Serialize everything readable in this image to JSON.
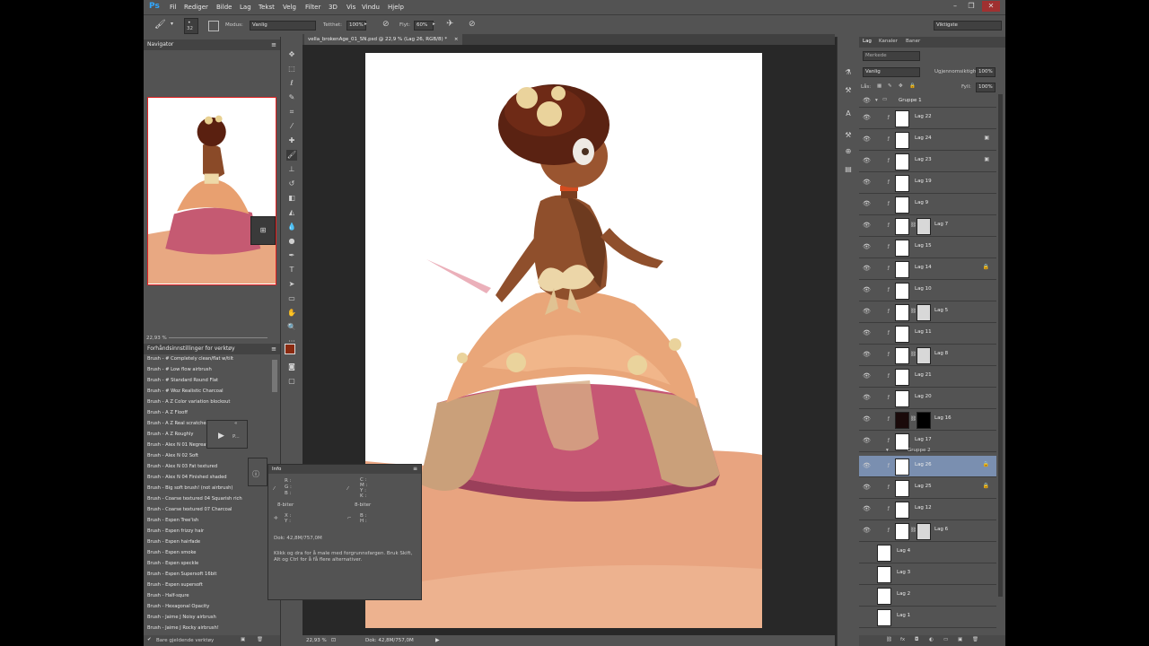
{
  "app": {
    "logo": "Ps"
  },
  "menu": [
    "Fil",
    "Rediger",
    "Bilde",
    "Lag",
    "Tekst",
    "Velg",
    "Filter",
    "3D",
    "Vis",
    "Vindu",
    "Hjelp"
  ],
  "options": {
    "brush_size": "32",
    "mode_label": "Modus:",
    "mode_value": "Vanlig",
    "opacity_label": "Tetthet:",
    "opacity_value": "100%",
    "flow_label": "Flyt:",
    "flow_value": "60%",
    "workspace": "Viktigste"
  },
  "document": {
    "tab_title": "vella_brokenAge_01_SN.psd @ 22,9 % (Lag 26, RGB/8) *",
    "zoom": "22,93 %",
    "doc_size": "Dok: 42,8M/757,0M"
  },
  "navigator": {
    "title": "Navigator",
    "zoom": "22,93 %"
  },
  "brush_presets": {
    "title": "Forhåndsinnstillinger for verktøy",
    "items": [
      "Brush - # Completely clean/flat w/tilt",
      "Brush - # Low flow airbrush",
      "Brush - # Standard Round Flat",
      "Brush - # Woz Realistic Charcoal",
      "Brush - A Z Color variation blockout",
      "Brush - A Z Flooff",
      "Brush - A Z Real scratches",
      "Brush - A Z Roughly",
      "Brush - Alex N 01 Negreat",
      "Brush - Alex N 02 Soft",
      "Brush - Alex N 03 Fat textured",
      "Brush - Alex N 04 Finished shaded",
      "Brush - Big soft brush! (not airbrush)",
      "Brush - Coarse textured 04 Squarish rich",
      "Brush - Coarse textured 07 Charcoal",
      "Brush - Espen Tree'ish",
      "Brush - Espen frizzy hair",
      "Brush - Espen hairfade",
      "Brush - Espen smoke",
      "Brush - Espen speckle",
      "Brush - Espen Supersoft 16bit",
      "Brush - Espen supersoft",
      "Brush - Half-squre",
      "Brush - Hexagonal Opacity",
      "Brush - Jaime J Noisy airbrush",
      "Brush - Jaime J Rocky airbrush!"
    ],
    "current_only": "Bare gjeldende verktøy"
  },
  "info_panel": {
    "title": "Info",
    "rgb": [
      "R :",
      "G :",
      "B :"
    ],
    "cmyk": [
      "C :",
      "M :",
      "Y :",
      "K :"
    ],
    "bits_left": "8-biter",
    "bits_right": "8-biter",
    "xy": [
      "X :",
      "Y :"
    ],
    "wh": [
      "B :",
      "H :"
    ],
    "doc": "Dok: 42,8M/757,0M",
    "hint": "Klikk og dra for å male med forgrunnsfargen. Bruk Skift, Alt og Ctrl for å få flere alternativer."
  },
  "layers_panel": {
    "tabs": [
      "Lag",
      "Kanaler",
      "Baner"
    ],
    "filter_placeholder": "Merkede",
    "blend_mode": "Vanlig",
    "opacity_label": "Ugjennomsiktighet:",
    "opacity_value": "100%",
    "lock_label": "Lås:",
    "fill_label": "Fyll:",
    "fill_value": "100%",
    "group1": "Gruppe 1",
    "group2": "Gruppe 2",
    "layers": [
      {
        "name": "Lag 22"
      },
      {
        "name": "Lag 24"
      },
      {
        "name": "Lag 23"
      },
      {
        "name": "Lag 19"
      },
      {
        "name": "Lag 9"
      },
      {
        "name": "Lag 7"
      },
      {
        "name": "Lag 15"
      },
      {
        "name": "Lag 14"
      },
      {
        "name": "Lag 10"
      },
      {
        "name": "Lag 5"
      },
      {
        "name": "Lag 11"
      },
      {
        "name": "Lag 8"
      },
      {
        "name": "Lag 21"
      },
      {
        "name": "Lag 20"
      },
      {
        "name": "Lag 16"
      },
      {
        "name": "Lag 17"
      },
      {
        "name": "Lag 26"
      },
      {
        "name": "Lag 25"
      },
      {
        "name": "Lag 12"
      },
      {
        "name": "Lag 6"
      },
      {
        "name": "Lag 4"
      },
      {
        "name": "Lag 3"
      },
      {
        "name": "Lag 2"
      },
      {
        "name": "Lag 1"
      }
    ]
  },
  "colors": {
    "ui_bg": "#535353",
    "canvas_bg": "#282828",
    "selection": "#7a8fb0",
    "foreground_swatch": "#8a2a10",
    "background_swatch": "#e8a060"
  }
}
